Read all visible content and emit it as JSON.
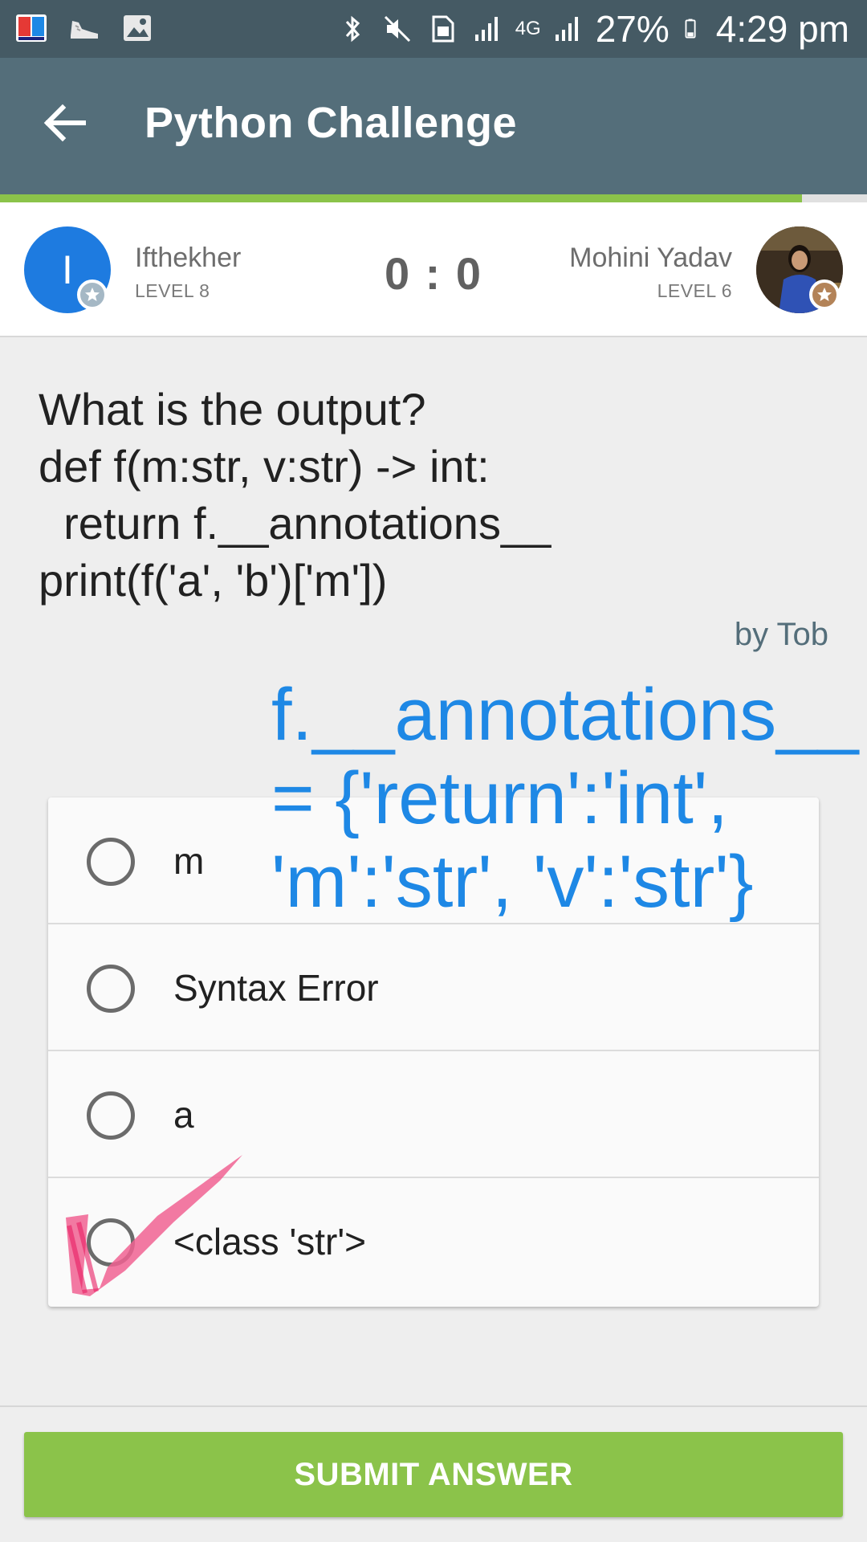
{
  "status_bar": {
    "left_icons": [
      "dictionary-app-icon",
      "shoe-icon",
      "image-icon"
    ],
    "right_icons": [
      "bluetooth-icon",
      "mute-icon",
      "sim-icon",
      "signal-icon",
      "4g-icon",
      "signal-icon",
      "battery-icon"
    ],
    "network_label": "4G",
    "battery": "27%",
    "time": "4:29 pm"
  },
  "app_bar": {
    "title": "Python Challenge",
    "back_icon": "arrow-back-icon",
    "progress_fraction": 0.925
  },
  "players": {
    "left": {
      "initial": "I",
      "name": "Ifthekher",
      "level": "LEVEL 8",
      "avatar_color": "#1e7be0",
      "badge_color": "#a5b8c5"
    },
    "score": "0 : 0",
    "right": {
      "name": "Mohini Yadav",
      "level": "LEVEL 6",
      "badge_color": "#b38358"
    }
  },
  "question": {
    "text": "What is the output?\ndef f(m:str, v:str) -> int:\n  return f.__annotations__\nprint(f('a', 'b')['m'])",
    "author": "by Tob"
  },
  "options": [
    {
      "label": "m"
    },
    {
      "label": "Syntax Error"
    },
    {
      "label": "a"
    },
    {
      "label": "<class 'str'>"
    }
  ],
  "annotation": {
    "text": "f.__annotations__\n= {'return':'int',\n'm':'str', 'v':'str'}",
    "color": "#1e88e5",
    "check_color": "#f06292"
  },
  "submit": {
    "label": "SUBMIT ANSWER",
    "color": "#8bc34a"
  },
  "colors": {
    "status_bar": "#455a64",
    "app_bar": "#546e7a",
    "background": "#eeeeee"
  }
}
